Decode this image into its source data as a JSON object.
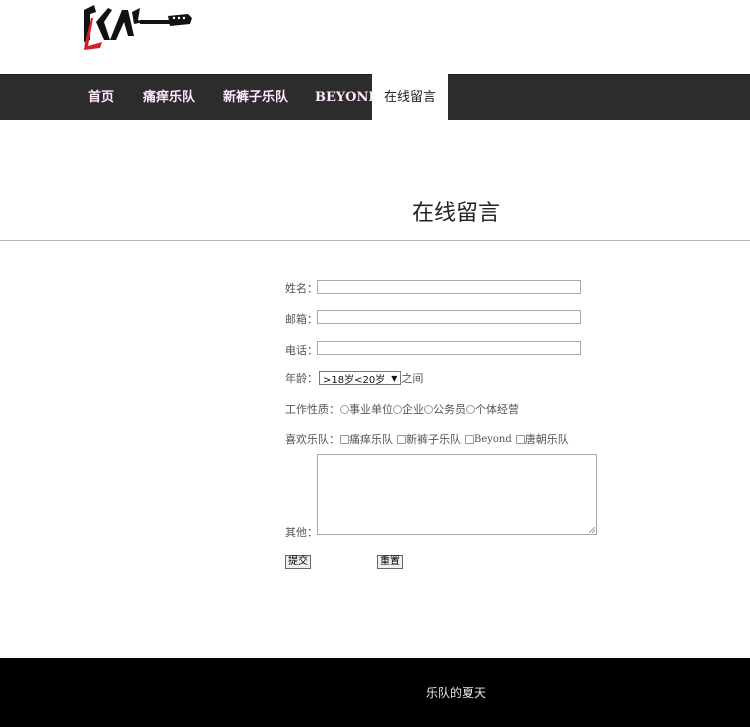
{
  "nav": {
    "items": [
      "首页",
      "痛痒乐队",
      "新裤子乐队",
      "BEYOND",
      "在线留言"
    ],
    "active": "在线留言"
  },
  "page": {
    "title": "在线留言"
  },
  "form": {
    "name_label": "姓名：",
    "email_label": "邮箱：",
    "phone_label": "电话：",
    "age_label": "年龄：",
    "age_selected": ">18岁<20岁",
    "age_suffix": "之间",
    "job_label": "工作性质：",
    "job_options": [
      "事业单位",
      "企业",
      "公务员",
      "个体经营"
    ],
    "band_label": "喜欢乐队：",
    "band_options": [
      "痛痒乐队",
      "新裤子乐队",
      "Beyond",
      "唐朝乐队"
    ],
    "other_label": "其他：",
    "submit_label": "提交",
    "reset_label": "重置"
  },
  "footer": {
    "text": "乐队的夏天"
  },
  "colors": {
    "navbar": "#2c2c2c",
    "footer": "#000000",
    "logo_red": "#d0202a"
  }
}
